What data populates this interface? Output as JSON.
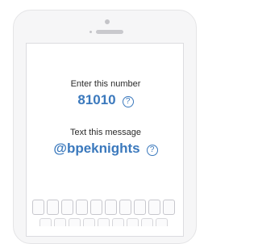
{
  "instruction": {
    "number_label": "Enter this number",
    "number_value": "81010",
    "message_label": "Text this message",
    "message_value": "@bpeknights",
    "help_glyph": "?"
  },
  "keyboard": {
    "row1_key_count": 10,
    "row2_key_count": 9
  },
  "colors": {
    "accent": "#3b79bd",
    "device": "#f6f6f7"
  }
}
